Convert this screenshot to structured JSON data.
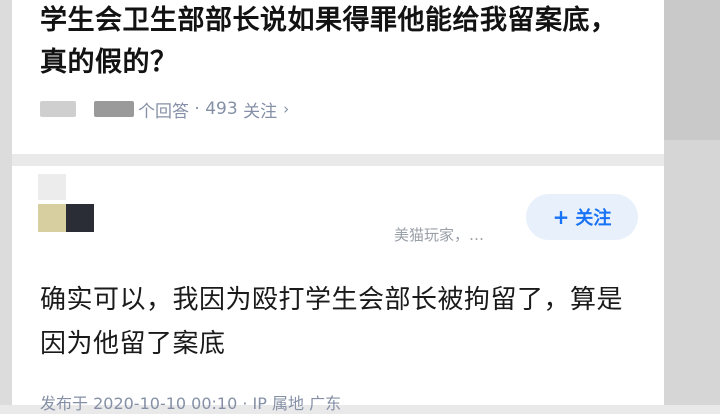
{
  "question": {
    "title": "学生会卫生部部长说如果得罪他能给我留案底，真的假的？",
    "meta": {
      "answers_suffix": "个回答",
      "separator": " · ",
      "follower_count": "493",
      "followers_label": "关注"
    }
  },
  "answer": {
    "follow_button": {
      "icon": "plus-icon",
      "label": "关注"
    },
    "author_badge": "美猫玩家，…",
    "content": "确实可以，我因为殴打学生会部长被拘留了，算是因为他留了案底",
    "footer": "发布于 2020-10-10 00:10 · IP 属地 广东"
  },
  "colors": {
    "accent": "#1772f6",
    "follow_bg": "#e8f0fc",
    "meta_text": "#8590a6",
    "title_text": "#121212"
  }
}
